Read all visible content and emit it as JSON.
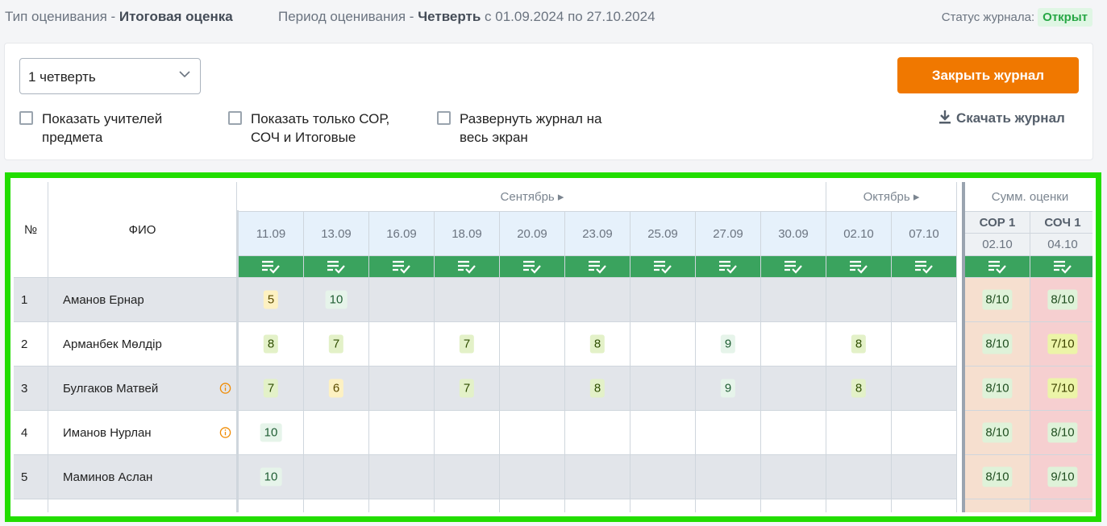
{
  "header": {
    "type_label": "Тип оценивания - ",
    "type_value": "Итоговая оценка",
    "period_label": "Период оценивания - ",
    "period_value": "Четверть",
    "period_range": " с 01.09.2024 по 27.10.2024",
    "status_label": "Статус журнала:",
    "status_value": "Открыт"
  },
  "controls": {
    "quarter_select": "1 четверть",
    "close_button": "Закрыть журнал",
    "download": "Скачать журнал",
    "checkboxes": [
      "Показать учителей\nпредмета",
      "Показать только СОР,\nСОЧ и Итоговые",
      "Развернуть журнал на\nвесь экран"
    ]
  },
  "table": {
    "col_no": "№",
    "col_name": "ФИО",
    "months": [
      {
        "label": "Сентябрь ▸"
      },
      {
        "label": "Октябрь ▸"
      }
    ],
    "sum_header": "Сумм. оценки",
    "dates": [
      "11.09",
      "13.09",
      "16.09",
      "18.09",
      "20.09",
      "23.09",
      "25.09",
      "27.09",
      "30.09",
      "02.10",
      "07.10"
    ],
    "sum_cols": [
      {
        "label": "СОР 1",
        "date": "02.10"
      },
      {
        "label": "СОЧ 1",
        "date": "04.10"
      }
    ],
    "rows": [
      {
        "no": "1",
        "name": "Аманов Ернар",
        "info": false,
        "grades": [
          "5",
          "10",
          "",
          "",
          "",
          "",
          "",
          "",
          "",
          "",
          ""
        ],
        "sor": "8/10",
        "soch": "8/10"
      },
      {
        "no": "2",
        "name": "Арманбек Мөлдір",
        "info": false,
        "grades": [
          "8",
          "7",
          "",
          "7",
          "",
          "8",
          "",
          "9",
          "",
          "8",
          ""
        ],
        "sor": "8/10",
        "soch": "7/10"
      },
      {
        "no": "3",
        "name": "Булгаков Матвей",
        "info": true,
        "grades": [
          "7",
          "6",
          "",
          "7",
          "",
          "8",
          "",
          "9",
          "",
          "8",
          ""
        ],
        "sor": "8/10",
        "soch": "7/10"
      },
      {
        "no": "4",
        "name": "Иманов Нурлан",
        "info": true,
        "grades": [
          "10",
          "",
          "",
          "",
          "",
          "",
          "",
          "",
          "",
          "",
          ""
        ],
        "sor": "8/10",
        "soch": "8/10"
      },
      {
        "no": "5",
        "name": "Маминов Аслан",
        "info": false,
        "grades": [
          "10",
          "",
          "",
          "",
          "",
          "",
          "",
          "",
          "",
          "",
          ""
        ],
        "sor": "8/10",
        "soch": "9/10"
      }
    ]
  },
  "colors": {
    "accent": "#f07800",
    "green": "#3aa35e",
    "highlight": "#22dd00"
  },
  "icons": {
    "grade_check": "list-check-icon",
    "info": "info-icon",
    "download": "download-icon",
    "chevron": "chevron-down-icon"
  }
}
